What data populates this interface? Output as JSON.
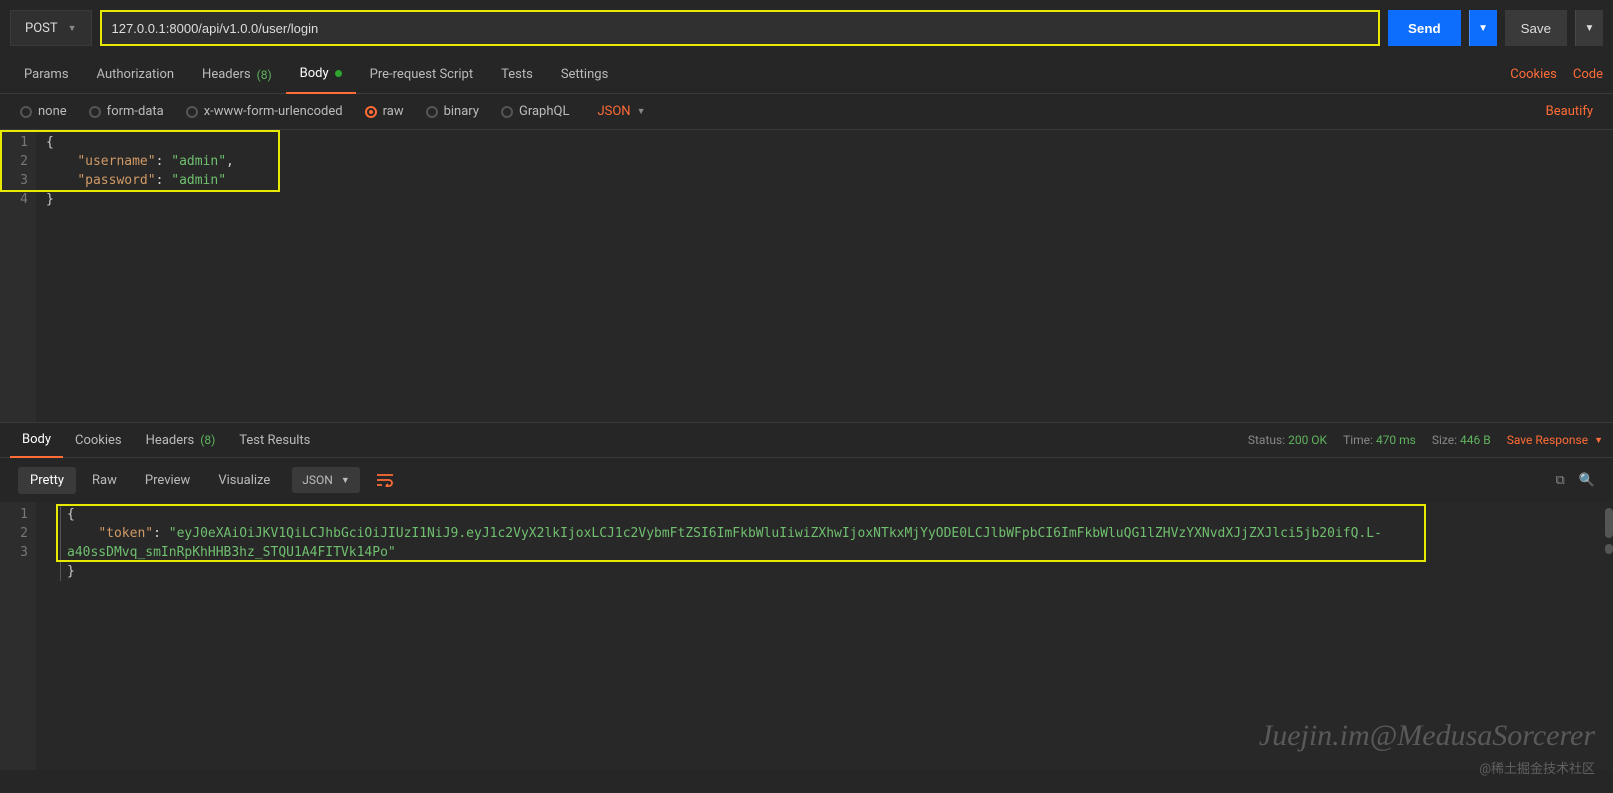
{
  "topbar": {
    "method": "POST",
    "url": "127.0.0.1:8000/api/v1.0.0/user/login",
    "send": "Send",
    "save": "Save"
  },
  "reqTabs": {
    "params": "Params",
    "auth": "Authorization",
    "headers": "Headers",
    "headersCount": "(8)",
    "body": "Body",
    "prereq": "Pre-request Script",
    "tests": "Tests",
    "settings": "Settings",
    "cookies": "Cookies",
    "code": "Code"
  },
  "bodyTypes": {
    "none": "none",
    "formdata": "form-data",
    "xwww": "x-www-form-urlencoded",
    "raw": "raw",
    "binary": "binary",
    "graphql": "GraphQL",
    "json": "JSON",
    "beautify": "Beautify"
  },
  "reqBody": {
    "l1": "{",
    "l2k": "\"username\"",
    "l2c": ": ",
    "l2v": "\"admin\"",
    "l2e": ",",
    "l3k": "\"password\"",
    "l3c": ": ",
    "l3v": "\"admin\"",
    "l4": "}",
    "n1": "1",
    "n2": "2",
    "n3": "3",
    "n4": "4"
  },
  "respTabs": {
    "body": "Body",
    "cookies": "Cookies",
    "headers": "Headers",
    "headersCount": "(8)",
    "tests": "Test Results"
  },
  "respMeta": {
    "statusL": "Status:",
    "statusV": "200 OK",
    "timeL": "Time:",
    "timeV": "470 ms",
    "sizeL": "Size:",
    "sizeV": "446 B",
    "save": "Save Response"
  },
  "viewTabs": {
    "pretty": "Pretty",
    "raw": "Raw",
    "preview": "Preview",
    "visualize": "Visualize",
    "dd": "JSON"
  },
  "respBody": {
    "n1": "1",
    "n2": "2",
    "n3": "3",
    "l1": "{",
    "l2k": "\"token\"",
    "l2c": ": ",
    "l2v": "\"eyJ0eXAiOiJKV1QiLCJhbGciOiJIUzI1NiJ9.eyJ1c2VyX2lkIjoxLCJ1c2VybmFtZSI6ImFkbWluIiwiZXhwIjoxNTkxMjYyODE0LCJlbWFpbCI6ImFkbWluQG1lZHVzYXNvdXJjZXJlci5jb20ifQ.L-a40ssDMvq_smInRpKhHHB3hz_STQU1A4FITVk14Po\"",
    "l3": "}"
  },
  "watermark": "Juejin.im@MedusaSorcerer",
  "credit": "@稀土掘金技术社区"
}
